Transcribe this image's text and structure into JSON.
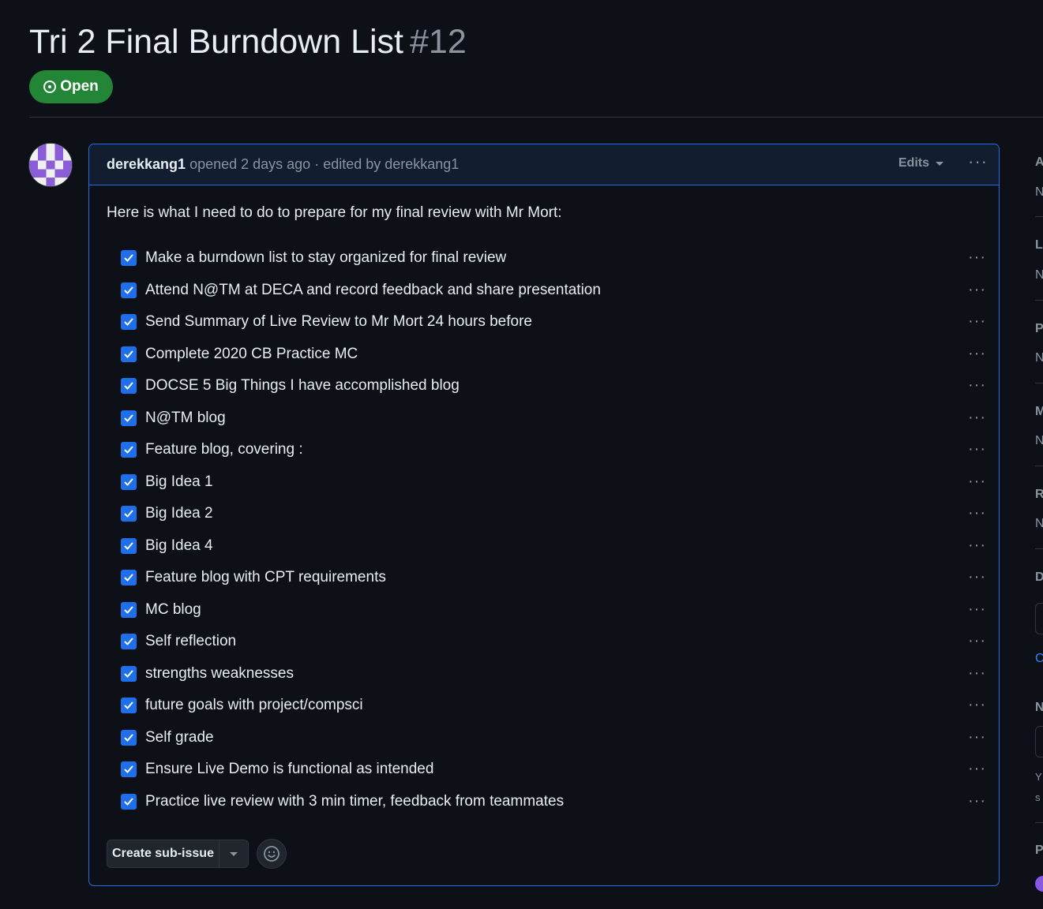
{
  "issue": {
    "title": "Tri 2 Final Burndown List",
    "number": "#12",
    "state_label": "Open"
  },
  "comment": {
    "author": "derekkang1",
    "meta": "opened 2 days ago · edited by derekkang1",
    "edits_label": "Edits",
    "more_label": "···",
    "intro": "Here is what I need to do to prepare for my final review with Mr Mort:",
    "tasks": [
      {
        "text": "Make a burndown list to stay organized for final review",
        "checked": true
      },
      {
        "text": "Attend N@TM at DECA and record feedback and share presentation",
        "checked": true
      },
      {
        "text": "Send Summary of Live Review to Mr Mort 24 hours before",
        "checked": true
      },
      {
        "text": "Complete 2020 CB Practice MC",
        "checked": true
      },
      {
        "text": "DOCSE 5 Big Things I have accomplished blog",
        "checked": true
      },
      {
        "text": "N@TM blog",
        "checked": true
      },
      {
        "text": "Feature blog, covering :",
        "checked": true
      },
      {
        "text": "Big Idea 1",
        "checked": true
      },
      {
        "text": "Big Idea 2",
        "checked": true
      },
      {
        "text": "Big Idea 4",
        "checked": true
      },
      {
        "text": "Feature blog with CPT requirements",
        "checked": true
      },
      {
        "text": "MC blog",
        "checked": true
      },
      {
        "text": "Self reflection",
        "checked": true
      },
      {
        "text": "strengths weaknesses",
        "checked": true
      },
      {
        "text": "future goals with project/compsci",
        "checked": true
      },
      {
        "text": "Self grade",
        "checked": true
      },
      {
        "text": "Ensure Live Demo is functional as intended",
        "checked": true
      },
      {
        "text": "Practice live review with 3 min timer, feedback from teammates",
        "checked": true
      }
    ],
    "create_sub_issue_label": "Create sub-issue"
  },
  "sidebar": {
    "truncated_headings": [
      "A",
      "L",
      "P",
      "M",
      "R",
      "D",
      "N",
      "P"
    ],
    "truncated_values": [
      "N",
      "N",
      "N",
      "N",
      "N"
    ],
    "truncated_link": "C",
    "truncated_note_lines": [
      "Y",
      "s"
    ]
  },
  "colors": {
    "background": "#0d1117",
    "accent_blue": "#1f6feb",
    "open_green": "#238636",
    "muted_text": "#8b949e"
  }
}
